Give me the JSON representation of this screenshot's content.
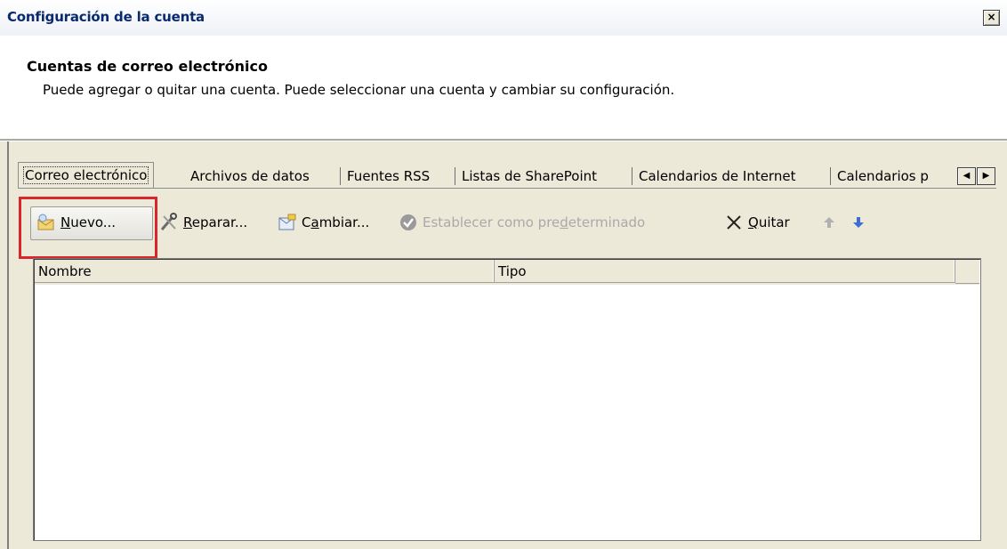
{
  "window": {
    "title": "Configuración de la cuenta",
    "close_symbol": "×"
  },
  "header": {
    "heading": "Cuentas de correo electrónico",
    "description": "Puede agregar o quitar una cuenta. Puede seleccionar una cuenta y cambiar su configuración."
  },
  "tabs": [
    {
      "label": "Correo electrónico",
      "active": true
    },
    {
      "label": "Archivos de datos"
    },
    {
      "label": "Fuentes RSS"
    },
    {
      "label": "Listas de SharePoint"
    },
    {
      "label": "Calendarios de Internet"
    },
    {
      "label": "Calendarios p"
    }
  ],
  "tab_scroll": {
    "left_icon": "scroll-left-icon",
    "right_icon": "scroll-right-icon"
  },
  "toolbar": {
    "new": {
      "pre": "",
      "accel": "N",
      "post": "uevo...",
      "icon": "new-account-icon"
    },
    "repair": {
      "pre": "",
      "accel": "R",
      "post": "eparar...",
      "icon": "repair-tools-icon"
    },
    "change": {
      "pre": "C",
      "accel": "a",
      "post": "mbiar...",
      "icon": "change-settings-icon"
    },
    "set_default": {
      "pre": "Establecer como pre",
      "accel": "d",
      "post": "eterminado",
      "icon": "checkmark-circle-icon",
      "disabled": true
    },
    "remove": {
      "pre": "",
      "accel": "Q",
      "post": "uitar",
      "icon": "remove-x-icon"
    },
    "move_up_icon": "arrow-up-icon",
    "move_down_icon": "arrow-down-icon"
  },
  "accounts_table": {
    "columns": [
      "Nombre",
      "Tipo"
    ],
    "rows": []
  },
  "colors": {
    "dialog_bg": "#ece9d8",
    "title_text": "#0a2a6e",
    "highlight": "#d9262c",
    "disabled_text": "#a9a9a9",
    "arrow_up": "#b0b0b0",
    "arrow_down": "#3b6fd6"
  }
}
